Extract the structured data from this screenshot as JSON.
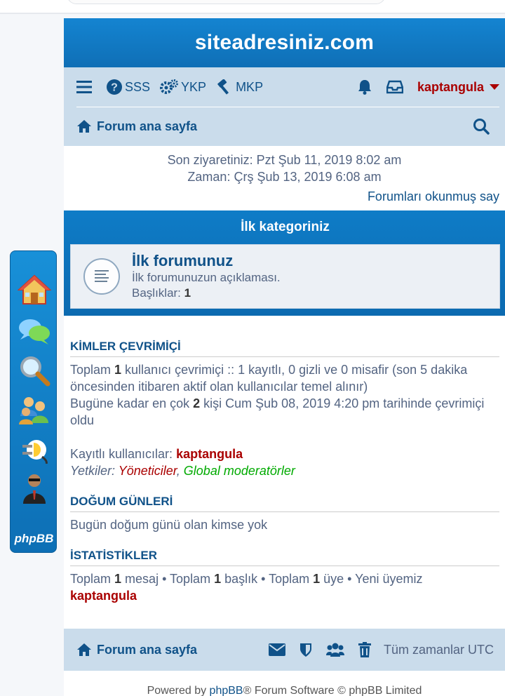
{
  "site": {
    "title": "siteadresiniz.com"
  },
  "nav": {
    "faq": "SSS",
    "ucp": "YKP",
    "mcp": "MKP",
    "username": "kaptangula",
    "home": "Forum ana sayfa"
  },
  "visit": {
    "last_visit": "Son ziyaretiniz: Pzt Şub 11, 2019 8:02 am",
    "current_time": "Zaman: Çrş Şub 13, 2019 6:08 am",
    "mark_read": "Forumları okunmuş say"
  },
  "category": {
    "title": "İlk kategoriniz",
    "forum": {
      "name": "İlk forumunuz",
      "description": "İlk forumunuzun açıklaması.",
      "topics_label": "Başlıklar:",
      "topics_count": "1"
    }
  },
  "online": {
    "title": "KİMLER ÇEVRİMİÇİ",
    "t1": "Toplam ",
    "count": "1",
    "t2": " kullanıcı çevrimiçi :: 1 kayıtlı, 0 gizli ve 0 misafir (son 5 dakika öncesinden itibaren aktif olan kullanıcılar temel alınır)",
    "t3": "Bugüne kadar en çok ",
    "record": "2",
    "t4": " kişi Cum Şub 08, 2019 4:20 pm tarihinde çevrimiçi oldu",
    "registered_label": "Kayıtlı kullanıcılar: ",
    "registered_user": "kaptangula",
    "legend_label": "Yetkiler: ",
    "role_admins": "Yöneticiler",
    "comma": ", ",
    "role_mods": "Global moderatörler"
  },
  "birthdays": {
    "title": "DOĞUM GÜNLERİ",
    "text": "Bugün doğum günü olan kimse yok"
  },
  "stats": {
    "title": "İSTATİSTİKLER",
    "a": "Toplam ",
    "posts": "1",
    "b": " mesaj • Toplam ",
    "topics": "1",
    "c": " başlık • Toplam ",
    "members": "1",
    "d": " üye • Yeni üyemiz ",
    "newest": "kaptangula"
  },
  "footer": {
    "home": "Forum ana sayfa",
    "timezone": "Tüm zamanlar UTC",
    "powered_pre": "Powered by ",
    "powered_link": "phpBB",
    "powered_post": "® Forum Software © phpBB Limited"
  },
  "dock": {
    "logo": "phpBB",
    "icons": [
      "home-icon",
      "chat-bubbles-icon",
      "magnifier-icon",
      "users-group-icon",
      "plug-icon",
      "admin-person-icon"
    ]
  },
  "colors": {
    "brand_blue": "#0f76c2",
    "nav_bg": "#cadceb",
    "link": "#105289",
    "user_red": "#aa0000",
    "mod_green": "#00aa00"
  }
}
